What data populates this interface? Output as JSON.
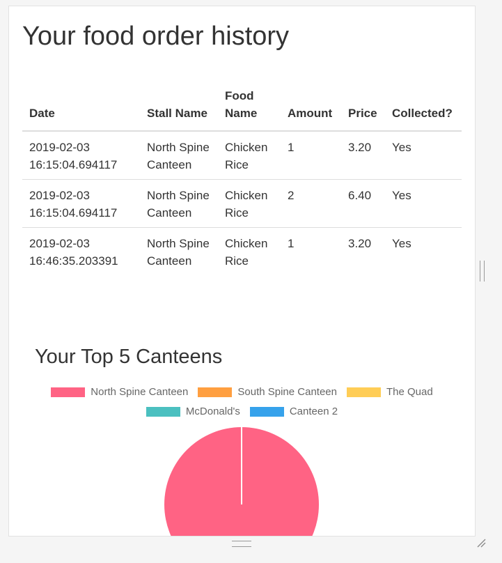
{
  "page": {
    "title": "Your food order history"
  },
  "table": {
    "headers": [
      "Date",
      "Stall Name",
      "Food Name",
      "Amount",
      "Price",
      "Collected?"
    ],
    "rows": [
      [
        "2019-02-03 16:15:04.694117",
        "North Spine Canteen",
        "Chicken Rice",
        "1",
        "3.20",
        "Yes"
      ],
      [
        "2019-02-03 16:15:04.694117",
        "North Spine Canteen",
        "Chicken Rice",
        "2",
        "6.40",
        "Yes"
      ],
      [
        "2019-02-03 16:46:35.203391",
        "North Spine Canteen",
        "Chicken Rice",
        "1",
        "3.20",
        "Yes"
      ]
    ]
  },
  "chart": {
    "heading": "Your Top 5 Canteens"
  },
  "chart_data": {
    "type": "pie",
    "title": "Your Top 5 Canteens",
    "categories": [
      "North Spine Canteen",
      "South Spine Canteen",
      "The Quad",
      "McDonald's",
      "Canteen 2"
    ],
    "values": [
      3,
      0,
      0,
      0,
      0
    ],
    "colors": [
      "#ff6384",
      "#ff9f40",
      "#ffcd56",
      "#4bc0c0",
      "#36a2eb"
    ],
    "legend_position": "top"
  }
}
